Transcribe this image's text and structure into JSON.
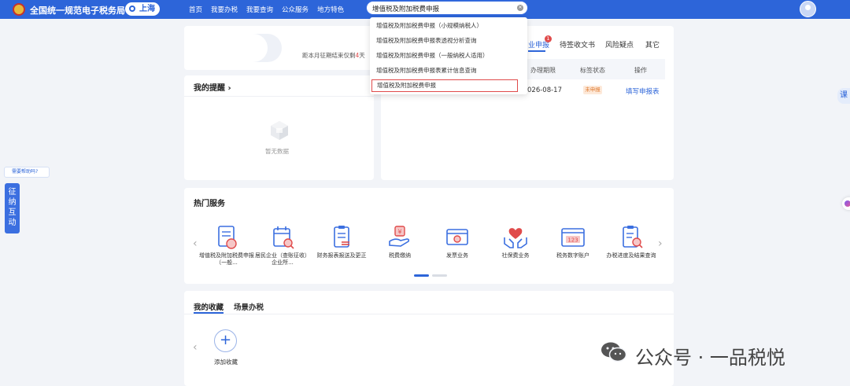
{
  "header": {
    "site_title": "全国统一规范电子税务局",
    "region": "上海",
    "nav": [
      "首页",
      "我要办税",
      "我要查询",
      "公众服务",
      "地方特色"
    ],
    "search_value": "增值税及附加税费申报"
  },
  "search_suggestions": [
    "增值税及附加税费申报（小规模纳税人）",
    "增值税及附加税费申报表透视分析查询",
    "增值税及附加税费申报（一般纳税人适用）",
    "增值税及附加税费申报表累计信息查询",
    "增值税及附加税费申报"
  ],
  "profile": {
    "deadline_prefix": "距本月征期结束仅剩",
    "deadline_days": "4",
    "deadline_suffix": "天"
  },
  "task_tabs": {
    "items": [
      "业申报",
      "待签收文书",
      "风险疑点",
      "其它"
    ],
    "badge": "1"
  },
  "task_table": {
    "headers": [
      "办理期限",
      "标签状态",
      "操作"
    ],
    "row": {
      "deadline": "026-08-17",
      "status": "未申报",
      "action": "填写申报表"
    }
  },
  "reminders": {
    "title": "我的提醒",
    "chevron": "›",
    "empty_text": "暂无数据"
  },
  "hot_services": {
    "title": "热门服务",
    "items": [
      {
        "label": "增值税及附加税费申报（一般...",
        "icon": "tax-form-icon"
      },
      {
        "label": "居民企业（查账征收）企业所...",
        "icon": "calendar-search-icon"
      },
      {
        "label": "财务报表报送及更正",
        "icon": "report-edit-icon"
      },
      {
        "label": "税费缴纳",
        "icon": "tax-payment-icon"
      },
      {
        "label": "发票业务",
        "icon": "invoice-icon"
      },
      {
        "label": "社保费业务",
        "icon": "social-insurance-icon"
      },
      {
        "label": "税务数字账户",
        "icon": "digital-account-icon"
      },
      {
        "label": "办税进度及结果查询",
        "icon": "progress-query-icon"
      }
    ],
    "prev": "‹",
    "next": "›"
  },
  "favorites": {
    "tab_active": "我的收藏",
    "tab_other": "场景办税",
    "add_label": "添加收藏",
    "prev": "‹",
    "plus": "+"
  },
  "sidebar": {
    "help_bubble": "需要帮助吗?",
    "interaction_tab": "征纳互动",
    "right_tab": "课"
  },
  "watermark": {
    "text": "公众号 · 一品税悦"
  },
  "colors": {
    "brand_blue": "#2d65d9",
    "alert_red": "#e04b4b",
    "pending_orange": "#e07a30"
  }
}
